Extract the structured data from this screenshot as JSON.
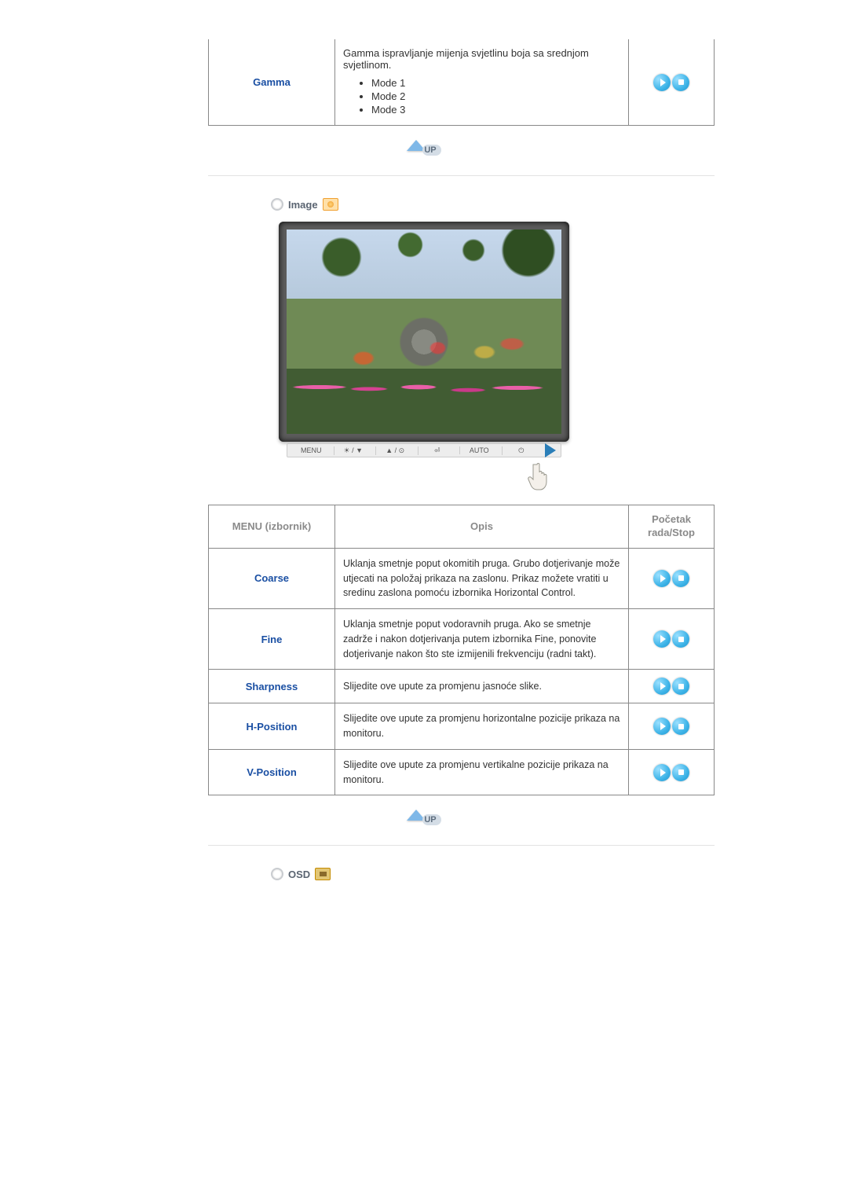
{
  "gamma": {
    "label": "Gamma",
    "desc_intro": "Gamma ispravljanje mijenja svjetlinu boja sa srednjom svjetlinom.",
    "modes": [
      "Mode 1",
      "Mode 2",
      "Mode 3"
    ]
  },
  "sections": {
    "image": {
      "title": "Image"
    },
    "osd": {
      "title": "OSD"
    }
  },
  "bezel_buttons": [
    "MENU",
    "☀ / ▼",
    "▲ / ⊙",
    "⏎",
    "AUTO",
    "⏻"
  ],
  "image_table": {
    "headers": {
      "menu": "MENU (izbornik)",
      "desc": "Opis",
      "action": "Početak rada/Stop"
    },
    "rows": [
      {
        "label": "Coarse",
        "desc": "Uklanja smetnje poput okomitih pruga. Grubo dotjerivanje može utjecati na položaj prikaza na zaslonu. Prikaz možete vratiti u sredinu zaslona pomoću izbornika Horizontal Control."
      },
      {
        "label": "Fine",
        "desc": "Uklanja smetnje poput vodoravnih pruga. Ako se smetnje zadrže i nakon dotjerivanja putem izbornika Fine, ponovite dotjerivanje nakon što ste izmijenili frekvenciju (radni takt)."
      },
      {
        "label": "Sharpness",
        "desc": "Slijedite ove upute za promjenu jasnoće slike."
      },
      {
        "label": "H-Position",
        "desc": "Slijedite ove upute za promjenu horizontalne pozicije prikaza na monitoru."
      },
      {
        "label": "V-Position",
        "desc": "Slijedite ove upute za promjenu vertikalne pozicije prikaza na monitoru."
      }
    ]
  },
  "up_label": "UP"
}
